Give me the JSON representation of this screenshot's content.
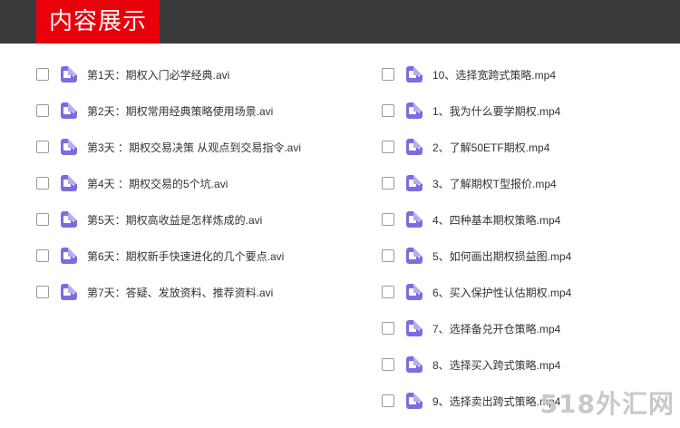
{
  "header": {
    "title": "内容展示"
  },
  "left_items": [
    {
      "label": "第1天：期权入门必学经典.avi"
    },
    {
      "label": "第2天：期权常用经典策略使用场景.avi"
    },
    {
      "label": "第3天 ：期权交易决策 从观点到交易指令.avi"
    },
    {
      "label": "第4天 ：期权交易的5个坑.avi"
    },
    {
      "label": "第5天：期权高收益是怎样炼成的.avi"
    },
    {
      "label": "第6天：期权新手快速进化的几个要点.avi"
    },
    {
      "label": "第7天：答疑、发放资料、推荐资料.avi"
    }
  ],
  "right_items": [
    {
      "label": "10、选择宽跨式策略.mp4"
    },
    {
      "label": "1、我为什么要学期权.mp4"
    },
    {
      "label": "2、了解50ETF期权.mp4"
    },
    {
      "label": "3、了解期权T型报价.mp4"
    },
    {
      "label": "4、四种基本期权策略.mp4"
    },
    {
      "label": "5、如何画出期权损益图.mp4"
    },
    {
      "label": "6、买入保护性认估期权.mp4"
    },
    {
      "label": "7、选择备兑开仓策略.mp4"
    },
    {
      "label": "8、选择买入跨式策略.mp4"
    },
    {
      "label": "9、选择卖出跨式策略.mp4"
    }
  ],
  "watermark": "518外汇网",
  "colors": {
    "header_bg": "#3a3a3c",
    "title_bg": "#e8000b",
    "icon": "#7b6de0"
  },
  "icons": {
    "file": "video-file-icon"
  }
}
